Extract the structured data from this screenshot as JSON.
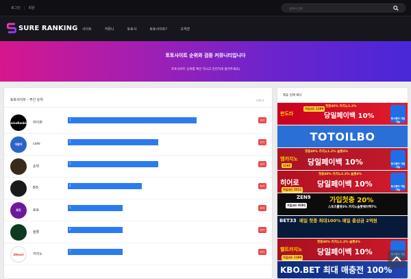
{
  "topbar": {
    "link1": "로그인",
    "link2": "회원",
    "sep": "|",
    "search_placeholder": "검색어 입력"
  },
  "nav": {
    "logo_text": "SURE RANKING",
    "menu": [
      "사이트",
      "커뮤니",
      "토토사",
      "토토사이트?",
      "고객센"
    ]
  },
  "hero": {
    "title": "토토사이트 순위와 검증 커뮤니티입니다",
    "subtitle": "토토사이트 순위를 확인 하시고 안전하게 즐겨주세요|"
  },
  "main": {
    "header": "토토사이트 - 주간 순위",
    "more": "더보기",
    "rows": [
      {
        "name": "하이퍼",
        "avatar": "CasinoRanking",
        "score": 0.47,
        "label": "1",
        "btn": "보기"
      },
      {
        "name": "cafe",
        "avatar": "아중이",
        "score": 0.33,
        "label": "2",
        "btn": "보기"
      },
      {
        "name": "순위",
        "avatar": "",
        "score": 0.33,
        "label": "3",
        "btn": "보기"
      },
      {
        "name": "BIS",
        "avatar": "",
        "score": 0.27,
        "label": "4",
        "btn": "보기"
      },
      {
        "name": "토토",
        "avatar": "토킷",
        "score": 0.2,
        "label": "5",
        "btn": "보기"
      },
      {
        "name": "슬롯",
        "avatar": "",
        "score": 0.2,
        "label": "6",
        "btn": "보기"
      },
      {
        "name": "카지노",
        "avatar": "3Heart",
        "score": 0.2,
        "label": "7",
        "btn": "보기"
      }
    ]
  },
  "side": {
    "header": "제휴 업체 배너",
    "banners": [
      {
        "main": "당일페이백 10%",
        "top": "첫충40% 카지노1.2%",
        "code": "가입코드 1189",
        "brand": "판도라",
        "bank": "토스뱅크 가입가능"
      },
      {
        "main": "TOTOILBO"
      },
      {
        "main": "당일페이백 10%",
        "top": "첫충40% 카지노1.2% 슬롯4%",
        "code": "1165",
        "brand": "엠카지노",
        "bank": "토스뱅크 가입가능"
      },
      {
        "main": "당일페이백 10%",
        "top": "첫충40% 카지노1.2% 슬롯4%",
        "code": "가입코드 5511",
        "brand": "히어로",
        "bank": "토스뱅크 가입가능"
      },
      {
        "main": "가입첫충 20%",
        "top": "스포츠룰렛3% 카지노슬롯페이백7%",
        "code": "가입코드 9191",
        "brand": "ZEN9"
      },
      {
        "main": "매일 첫충 최대100% 매일 총상금 2억원",
        "brand": "BET33"
      },
      {
        "main": "당일페이백 10%",
        "top": "첫충40% 카지노1.2% 슬롯4%",
        "code": "가입코드 1189",
        "brand": "벨트카지노",
        "bank": "토스뱅크 가입가능"
      },
      {
        "main": "KBO.BET 최대 매충전 100%"
      }
    ]
  }
}
